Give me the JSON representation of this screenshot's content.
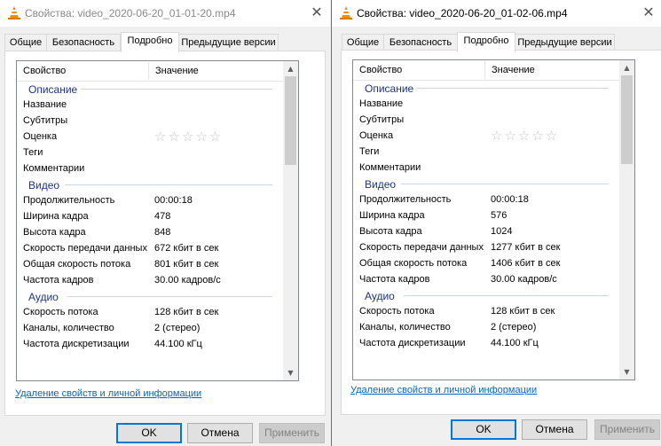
{
  "windows": [
    {
      "title": "Свойства: video_2020-06-20_01-01-20.mp4",
      "tabs": [
        "Общие",
        "Безопасность",
        "Подробно",
        "Предыдущие версии"
      ],
      "active_tab": 2,
      "header": {
        "property": "Свойство",
        "value": "Значение"
      },
      "groups": {
        "description": "Описание",
        "video": "Видео",
        "audio": "Аудио"
      },
      "description": [
        {
          "k": "Название",
          "v": ""
        },
        {
          "k": "Субтитры",
          "v": ""
        },
        {
          "k": "Оценка",
          "v": "☆☆☆☆☆"
        },
        {
          "k": "Теги",
          "v": ""
        },
        {
          "k": "Комментарии",
          "v": ""
        }
      ],
      "video": [
        {
          "k": "Продолжительность",
          "v": "00:00:18"
        },
        {
          "k": "Ширина кадра",
          "v": "478"
        },
        {
          "k": "Высота кадра",
          "v": "848"
        },
        {
          "k": "Скорость передачи данных",
          "v": "672 кбит в сек"
        },
        {
          "k": "Общая скорость потока",
          "v": "801 кбит в сек"
        },
        {
          "k": "Частота кадров",
          "v": "30.00 кадров/с"
        }
      ],
      "audio": [
        {
          "k": "Скорость потока",
          "v": "128 кбит в сек"
        },
        {
          "k": "Каналы, количество",
          "v": "2 (стерео)"
        },
        {
          "k": "Частота дискретизации",
          "v": "44.100 кГц"
        }
      ],
      "link": "Удаление свойств и личной информации",
      "buttons": {
        "ok": "OK",
        "cancel": "Отмена",
        "apply": "Применить"
      }
    },
    {
      "title": "Свойства: video_2020-06-20_01-02-06.mp4",
      "tabs": [
        "Общие",
        "Безопасность",
        "Подробно",
        "Предыдущие версии"
      ],
      "active_tab": 2,
      "header": {
        "property": "Свойство",
        "value": "Значение"
      },
      "groups": {
        "description": "Описание",
        "video": "Видео",
        "audio": "Аудио"
      },
      "description": [
        {
          "k": "Название",
          "v": ""
        },
        {
          "k": "Субтитры",
          "v": ""
        },
        {
          "k": "Оценка",
          "v": "☆☆☆☆☆"
        },
        {
          "k": "Теги",
          "v": ""
        },
        {
          "k": "Комментарии",
          "v": ""
        }
      ],
      "video": [
        {
          "k": "Продолжительность",
          "v": "00:00:18"
        },
        {
          "k": "Ширина кадра",
          "v": "576"
        },
        {
          "k": "Высота кадра",
          "v": "1024"
        },
        {
          "k": "Скорость передачи данных",
          "v": "1277 кбит в сек"
        },
        {
          "k": "Общая скорость потока",
          "v": "1406 кбит в сек"
        },
        {
          "k": "Частота кадров",
          "v": "30.00 кадров/с"
        }
      ],
      "audio": [
        {
          "k": "Скорость потока",
          "v": "128 кбит в сек"
        },
        {
          "k": "Каналы, количество",
          "v": "2 (стерео)"
        },
        {
          "k": "Частота дискретизации",
          "v": "44.100 кГц"
        }
      ],
      "link": "Удаление свойств и личной информации",
      "buttons": {
        "ok": "OK",
        "cancel": "Отмена",
        "apply": "Применить"
      }
    }
  ],
  "icons": {
    "title": "vlc-cone-icon",
    "close": "close-icon",
    "scroll_up": "scroll-up-arrow-icon",
    "scroll_down": "scroll-down-arrow-icon"
  },
  "colors": {
    "group_heading": "#1e3287",
    "link": "#0066cc",
    "accent_border": "#0078d7"
  }
}
